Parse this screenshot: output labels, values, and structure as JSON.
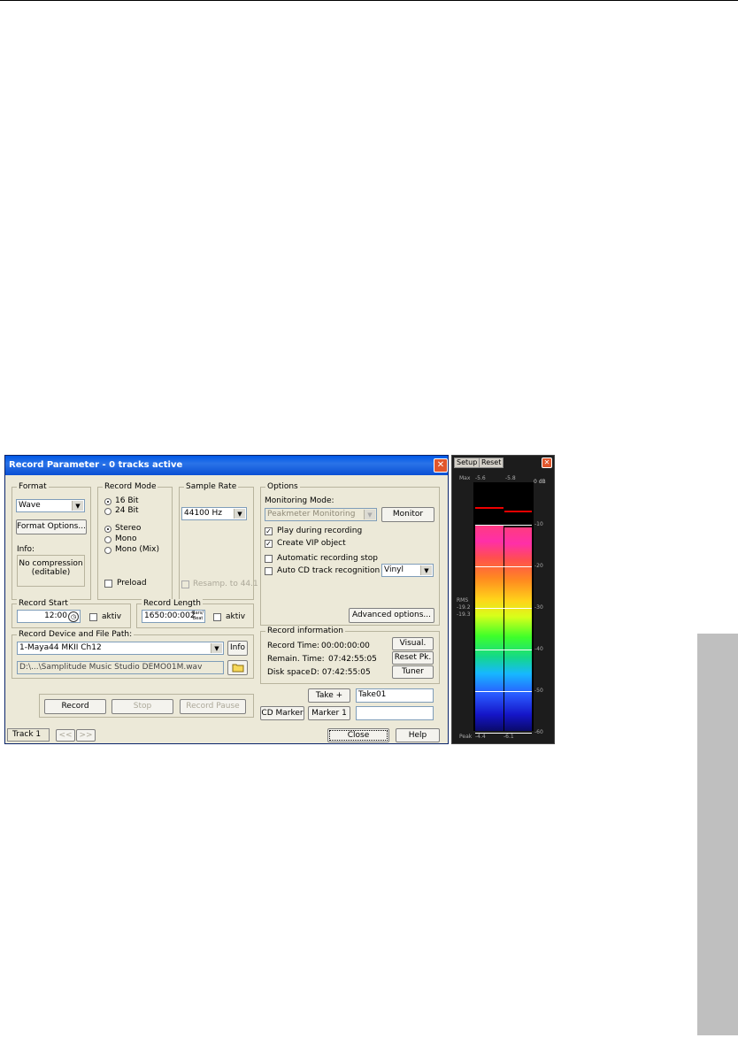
{
  "dialog": {
    "title": "Record Parameter - 0 tracks active",
    "format": {
      "group": "Format",
      "value": "Wave",
      "options_button": "Format Options...",
      "info_label": "Info:",
      "info_line1": "No compression",
      "info_line2": "(editable)"
    },
    "record_mode": {
      "group": "Record Mode",
      "bit16": "16 Bit",
      "bit24": "24 Bit",
      "stereo": "Stereo",
      "mono": "Mono",
      "mono_mix": "Mono (Mix)",
      "preload": "Preload"
    },
    "sample_rate": {
      "group": "Sample Rate",
      "value": "44100 Hz",
      "resamp": "Resamp. to 44.1"
    },
    "options": {
      "group": "Options",
      "monitoring_mode_label": "Monitoring Mode:",
      "monitoring_mode_value": "Peakmeter Monitoring",
      "monitor_button": "Monitor",
      "play_during": "Play during recording",
      "create_vip": "Create VIP object",
      "auto_stop": "Automatic recording stop",
      "auto_cd": "Auto CD track recognition",
      "vinyl": "Vinyl",
      "advanced": "Advanced options..."
    },
    "record_start": {
      "group": "Record Start",
      "value": "12:00",
      "aktiv": "aktiv"
    },
    "record_length": {
      "group": "Record Length",
      "value": "1650:00:002",
      "unit_top": "Bars/",
      "unit_bottom": "Beat",
      "aktiv": "aktiv"
    },
    "device": {
      "group": "Record Device and File Path:",
      "value": "1-Maya44 MKII Ch12",
      "info_button": "Info",
      "path": "D:\\...\\Samplitude Music Studio DEMO01M.wav"
    },
    "record_info": {
      "group": "Record information",
      "record_time_label": "Record Time:",
      "record_time_value": "00:00:00:00",
      "remain_label": "Remain. Time:",
      "remain_value": "07:42:55:05",
      "disk_label": "Disk space",
      "disk_value": "D: 07:42:55:05",
      "visual": "Visual.",
      "reset_pk": "Reset Pk.",
      "tuner": "Tuner"
    },
    "take_button": "Take +",
    "take_value": "Take01",
    "cd_marker": "CD Marker",
    "marker1": "Marker 1",
    "marker_value": "",
    "record_button": "Record",
    "stop_button": "Stop",
    "pause_button": "Record Pause",
    "track_label": "Track 1",
    "prev": "<<",
    "next": ">>",
    "close_button": "Close",
    "help_button": "Help"
  },
  "meter": {
    "tab_setup": "Setup",
    "tab_reset": "Reset",
    "max_label": "Max",
    "max_l": "-5.6",
    "max_r": "-5.8",
    "db0": "0 dB",
    "rms_label": "RMS",
    "rms_l": "-19.2",
    "rms_r": "-19.3",
    "peak_label": "Peak",
    "peak_l": "-4.4",
    "peak_r": "-6.1",
    "scale": [
      "-10",
      "-20",
      "-30",
      "-40",
      "-50",
      "-60"
    ],
    "level_left": 0.83,
    "level_right": 0.82
  }
}
